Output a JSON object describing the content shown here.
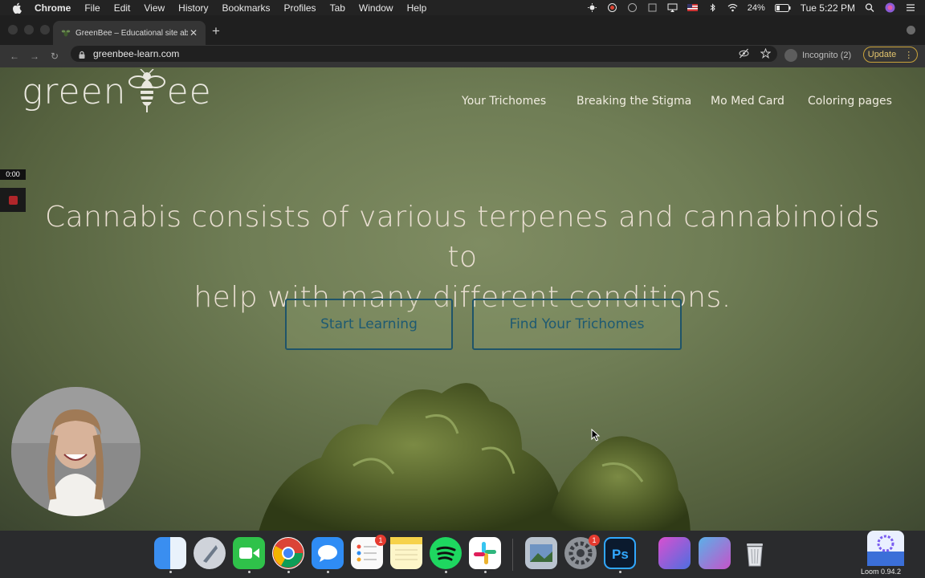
{
  "menubar": {
    "items": [
      "Chrome",
      "File",
      "Edit",
      "View",
      "History",
      "Bookmarks",
      "Profiles",
      "Tab",
      "Window",
      "Help"
    ],
    "battery": "24%",
    "clock": "Tue 5:22 PM"
  },
  "browser": {
    "tab_title": "GreenBee – Educational site ab",
    "url": "greenbee-learn.com",
    "incognito_label": "Incognito (2)",
    "update_label": "Update"
  },
  "site": {
    "logo_left": "green",
    "logo_right": "ee",
    "nav": [
      "Your Trichomes",
      "Breaking the Stigma",
      "Mo Med Card",
      "Coloring pages"
    ],
    "hero_line1": "Cannabis consists of various terpenes and cannabinoids to",
    "hero_line2": "help with many different conditions.",
    "buttons": {
      "start": "Start Learning",
      "find": "Find Your Trichomes"
    }
  },
  "recording": {
    "timer": "0:00"
  },
  "dock": {
    "apps": [
      "finder",
      "launchpad",
      "facetime",
      "chrome",
      "messages",
      "reminders",
      "notes",
      "spotify",
      "slack",
      "preview",
      "system-preferences",
      "photoshop",
      "stacks-1",
      "stacks-2",
      "trash",
      "loom"
    ],
    "reminders_badge": "1",
    "sysprefs_badge": "1",
    "loom_label": "Loom 0.94.2"
  },
  "colors": {
    "button_border": "#1f5469",
    "button_text": "#1e5a72",
    "hero_text": "#eadfd2",
    "background_green": "#6f7d55"
  }
}
